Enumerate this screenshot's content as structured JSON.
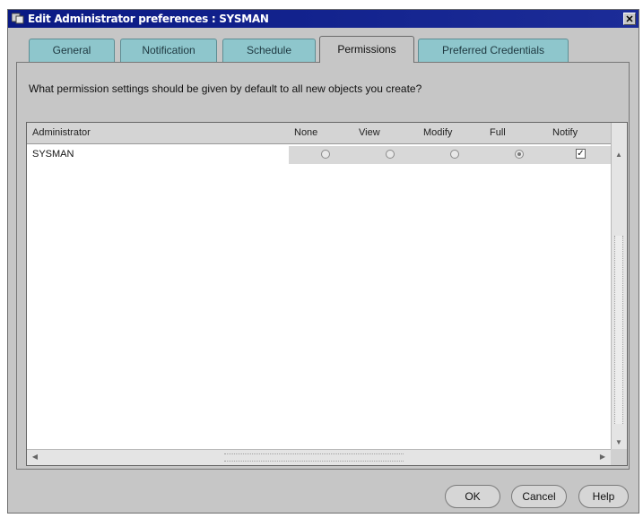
{
  "window": {
    "title": "Edit Administrator preferences : SYSMAN",
    "close_label": "✕"
  },
  "tabs": [
    {
      "label": "General"
    },
    {
      "label": "Notification"
    },
    {
      "label": "Schedule"
    },
    {
      "label": "Permissions"
    },
    {
      "label": "Preferred Credentials"
    }
  ],
  "active_tab": "Permissions",
  "question": "What permission settings should be given by default to all new objects you create?",
  "table": {
    "columns": [
      "Administrator",
      "None",
      "View",
      "Modify",
      "Full",
      "Notify"
    ],
    "rows": [
      {
        "administrator": "SYSMAN",
        "permission": "Full",
        "notify": true,
        "notify_mark": "✓"
      }
    ]
  },
  "buttons": {
    "ok": "OK",
    "cancel": "Cancel",
    "help": "Help"
  },
  "icons": {
    "app": "app-window-icon",
    "close": "close-icon"
  }
}
